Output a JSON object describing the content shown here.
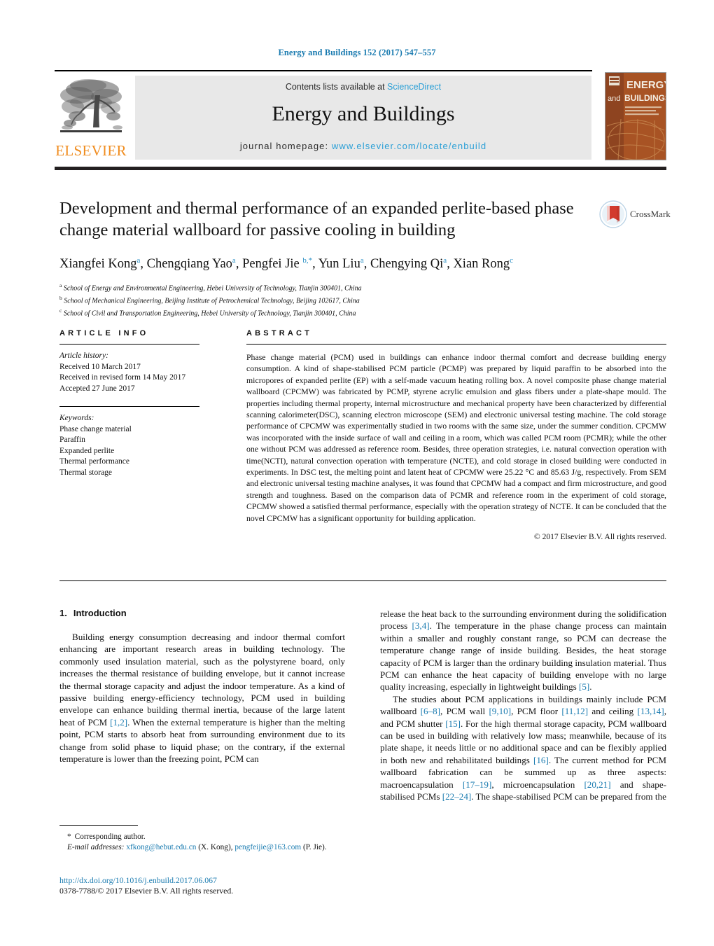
{
  "running_head": "Energy and Buildings 152 (2017) 547–557",
  "masthead": {
    "contents_prefix": "Contents lists available at ",
    "sciencedirect": "ScienceDirect",
    "journal_title": "Energy and Buildings",
    "homepage_prefix": "journal homepage: ",
    "homepage_url": "www.elsevier.com/locate/enbuild",
    "publisher_logo_text": "ELSEVIER",
    "cover_line1": "ENERGY",
    "cover_line2": "and",
    "cover_line3": "BUILDINGS",
    "colors": {
      "link": "#2a9fd6",
      "elsevier_orange": "#F08C1E",
      "panel_gray": "#e8e8e8",
      "cover_orange": "#b25a26"
    }
  },
  "crossmark": {
    "label": "CrossMark"
  },
  "title": "Development and thermal performance of an expanded perlite-based phase change material wallboard for passive cooling in building",
  "authors_html": "Xiangfei Kong<sup>a</sup>, Chengqiang Yao<sup>a</sup>, Pengfei Jie <sup>b,*</sup>, Yun Liu<sup>a</sup>, Chengying Qi<sup>a</sup>, Xian Rong<sup>c</sup>",
  "affiliations": [
    {
      "mark": "a",
      "text": "School of Energy and Environmental Engineering, Hebei University of Technology, Tianjin 300401, China"
    },
    {
      "mark": "b",
      "text": "School of Mechanical Engineering, Beijing Institute of Petrochemical Technology, Beijing 102617, China"
    },
    {
      "mark": "c",
      "text": "School of Civil and Transportation Engineering, Hebei University of Technology, Tianjin 300401, China"
    }
  ],
  "article_info": {
    "heading": "ARTICLE INFO",
    "history_label": "Article history:",
    "history": [
      "Received 10 March 2017",
      "Received in revised form 14 May 2017",
      "Accepted 27 June 2017"
    ],
    "keywords_label": "Keywords:",
    "keywords": [
      "Phase change material",
      "Paraffin",
      "Expanded perlite",
      "Thermal performance",
      "Thermal storage"
    ]
  },
  "abstract": {
    "heading": "ABSTRACT",
    "text": "Phase change material (PCM) used in buildings can enhance indoor thermal comfort and decrease building energy consumption. A kind of shape-stabilised PCM particle (PCMP) was prepared by liquid paraffin to be absorbed into the micropores of expanded perlite (EP) with a self-made vacuum heating rolling box. A novel composite phase change material wallboard (CPCMW) was fabricated by PCMP, styrene acrylic emulsion and glass fibers under a plate-shape mould. The properties including thermal property, internal microstructure and mechanical property have been characterized by differential scanning calorimeter(DSC), scanning electron microscope (SEM) and electronic universal testing machine. The cold storage performance of CPCMW was experimentally studied in two rooms with the same size, under the summer condition. CPCMW was incorporated with the inside surface of wall and ceiling in a room, which was called PCM room (PCMR); while the other one without PCM was addressed as reference room. Besides, three operation strategies, i.e. natural convection operation with time(NCTI), natural convection operation with temperature (NCTE), and cold storage in closed building were conducted in experiments. In DSC test, the melting point and latent heat of CPCMW were 25.22 °C and 85.63 J/g, respectively. From SEM and electronic universal testing machine analyses, it was found that CPCMW had a compact and firm microstructure, and good strength and toughness. Based on the comparison data of PCMR and reference room in the experiment of cold storage, CPCMW showed a satisfied thermal performance, especially with the operation strategy of NCTE. It can be concluded that the novel CPCMW has a significant opportunity for building application.",
    "copyright": "© 2017 Elsevier B.V. All rights reserved."
  },
  "introduction": {
    "number": "1.",
    "heading": "Introduction",
    "left_paragraph_html": "Building energy consumption decreasing and indoor thermal comfort enhancing are important research areas in building technology. The commonly used insulation material, such as the polystyrene board, only increases the thermal resistance of building envelope, but it cannot increase the thermal storage capacity and adjust the indoor temperature. As a kind of passive building energy-efficiency technology, PCM used in building envelope can enhance building thermal inertia, because of the large latent heat of PCM <span class=\"ref\">[1,2]</span>. When the external temperature is higher than the melting point, PCM starts to absorb heat from surrounding environment due to its change from solid phase to liquid phase; on the contrary, if the external temperature is lower than the freezing point, PCM can",
    "right_paragraph1_html": "release the heat back to the surrounding environment during the solidification process <span class=\"ref\">[3,4]</span>. The temperature in the phase change process can maintain within a smaller and roughly constant range, so PCM can decrease the temperature change range of inside building. Besides, the heat storage capacity of PCM is larger than the ordinary building insulation material. Thus PCM can enhance the heat capacity of building envelope with no large quality increasing, especially in lightweight buildings <span class=\"ref\">[5]</span>.",
    "right_paragraph2_html": "The studies about PCM applications in buildings mainly include PCM wallboard <span class=\"ref\">[6–8]</span>, PCM wall <span class=\"ref\">[9,10]</span>, PCM floor <span class=\"ref\">[11,12]</span> and ceiling <span class=\"ref\">[13,14]</span>, and PCM shutter <span class=\"ref\">[15]</span>. For the high thermal storage capacity, PCM wallboard can be used in building with relatively low mass; meanwhile, because of its plate shape, it needs little or no additional space and can be flexibly applied in both new and rehabilitated buildings <span class=\"ref\">[16]</span>. The current method for PCM wallboard fabrication can be summed up as three aspects: macroencapsulation <span class=\"ref\">[17–19]</span>, microencapsulation <span class=\"ref\">[20,21]</span> and shape-stabilised PCMs <span class=\"ref\">[22–24]</span>. The shape-stabilised PCM can be prepared from the"
  },
  "footnote": {
    "star": "*",
    "corresponding": "Corresponding author.",
    "email_label": "E-mail addresses:",
    "email1": "xfkong@hebut.edu.cn",
    "email1_name": "(X. Kong),",
    "email2": "pengfeijie@163.com",
    "email2_name": "(P. Jie).",
    "doi": "http://dx.doi.org/10.1016/j.enbuild.2017.06.067",
    "issn": "0378-7788/© 2017 Elsevier B.V. All rights reserved."
  }
}
